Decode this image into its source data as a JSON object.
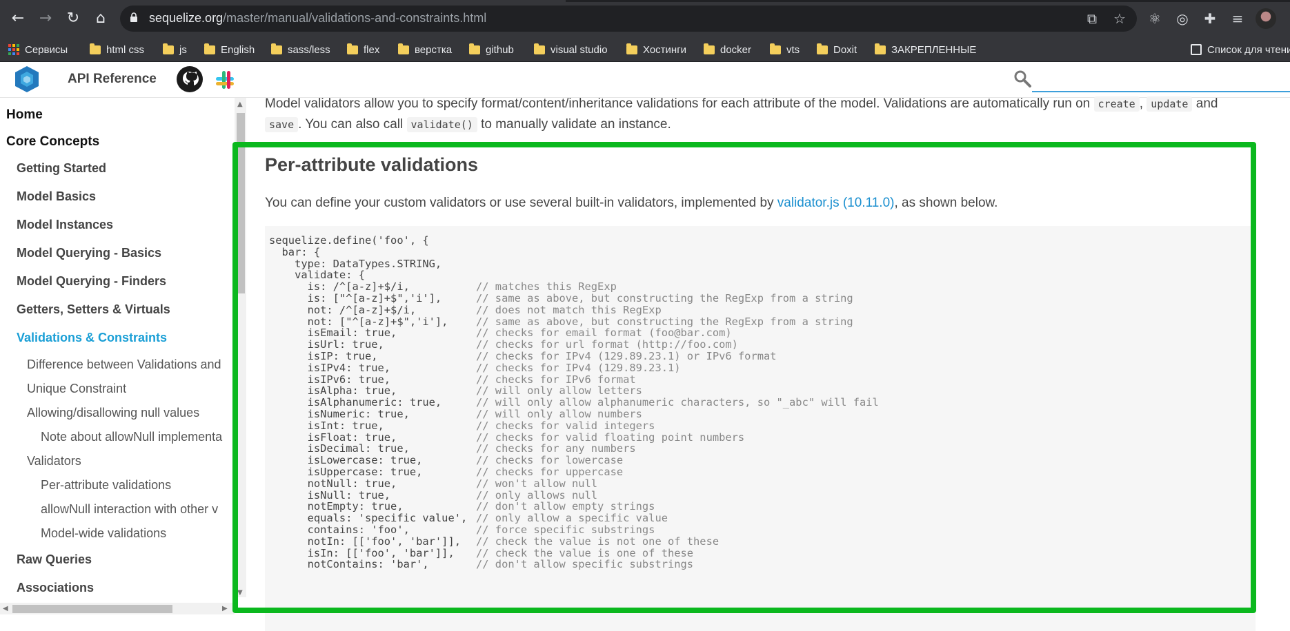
{
  "browser": {
    "url_host": "sequelize.org",
    "url_path": "/master/manual/validations-and-constraints.html"
  },
  "bookmarks": {
    "apps_label": "Сервисы",
    "items": [
      "html css",
      "js",
      "English",
      "sass/less",
      "flex",
      "верстка",
      "github",
      "visual studio",
      "Хостинги",
      "docker",
      "vts",
      "Doxit",
      "ЗАКРЕПЛЕННЫЕ"
    ],
    "reading_list": "Список для чтени"
  },
  "header": {
    "title": "API Reference",
    "search_value": ""
  },
  "sidebar": {
    "home": "Home",
    "core": "Core Concepts",
    "items": [
      "Getting Started",
      "Model Basics",
      "Model Instances",
      "Model Querying - Basics",
      "Model Querying - Finders",
      "Getters, Setters & Virtuals",
      "Validations & Constraints"
    ],
    "sub": [
      "Difference between Validations and",
      "Unique Constraint",
      "Allowing/disallowing null values",
      "Note about allowNull implementa",
      "Validators",
      "Per-attribute validations",
      "allowNull interaction with other v",
      "Model-wide validations"
    ],
    "after": [
      "Raw Queries",
      "Associations"
    ]
  },
  "content": {
    "intro_1": "Model validators allow you to specify format/content/inheritance validations for each attribute of the model. Validations are automatically run on ",
    "code_create": "create",
    "sep1": ", ",
    "code_update": "update",
    "and": " and",
    "code_save": "save",
    "intro_2": ". You can also call ",
    "code_validate": "validate()",
    "intro_3": " to manually validate an instance.",
    "heading": "Per-attribute validations",
    "para_1": "You can define your custom validators or use several built-in validators, implemented by ",
    "para_link": "validator.js (10.11.0)",
    "para_2": ", as shown below.",
    "code_lines": [
      {
        "code": "sequelize.define('foo', {",
        "comment": ""
      },
      {
        "code": "  bar: {",
        "comment": ""
      },
      {
        "code": "    type: DataTypes.STRING,",
        "comment": ""
      },
      {
        "code": "    validate: {",
        "comment": ""
      },
      {
        "code": "      is: /^[a-z]+$/i,",
        "comment": "// matches this RegExp"
      },
      {
        "code": "      is: [\"^[a-z]+$\",'i'],",
        "comment": "// same as above, but constructing the RegExp from a string"
      },
      {
        "code": "      not: /^[a-z]+$/i,",
        "comment": "// does not match this RegExp"
      },
      {
        "code": "      not: [\"^[a-z]+$\",'i'],",
        "comment": "// same as above, but constructing the RegExp from a string"
      },
      {
        "code": "      isEmail: true,",
        "comment": "// checks for email format (foo@bar.com)"
      },
      {
        "code": "      isUrl: true,",
        "comment": "// checks for url format (http://foo.com)"
      },
      {
        "code": "      isIP: true,",
        "comment": "// checks for IPv4 (129.89.23.1) or IPv6 format"
      },
      {
        "code": "      isIPv4: true,",
        "comment": "// checks for IPv4 (129.89.23.1)"
      },
      {
        "code": "      isIPv6: true,",
        "comment": "// checks for IPv6 format"
      },
      {
        "code": "      isAlpha: true,",
        "comment": "// will only allow letters"
      },
      {
        "code": "      isAlphanumeric: true,",
        "comment": "// will only allow alphanumeric characters, so \"_abc\" will fail"
      },
      {
        "code": "      isNumeric: true,",
        "comment": "// will only allow numbers"
      },
      {
        "code": "      isInt: true,",
        "comment": "// checks for valid integers"
      },
      {
        "code": "      isFloat: true,",
        "comment": "// checks for valid floating point numbers"
      },
      {
        "code": "      isDecimal: true,",
        "comment": "// checks for any numbers"
      },
      {
        "code": "      isLowercase: true,",
        "comment": "// checks for lowercase"
      },
      {
        "code": "      isUppercase: true,",
        "comment": "// checks for uppercase"
      },
      {
        "code": "      notNull: true,",
        "comment": "// won't allow null"
      },
      {
        "code": "      isNull: true,",
        "comment": "// only allows null"
      },
      {
        "code": "      notEmpty: true,",
        "comment": "// don't allow empty strings"
      },
      {
        "code": "      equals: 'specific value',",
        "comment": "// only allow a specific value"
      },
      {
        "code": "      contains: 'foo',",
        "comment": "// force specific substrings"
      },
      {
        "code": "      notIn: [['foo', 'bar']],",
        "comment": "// check the value is not one of these"
      },
      {
        "code": "      isIn: [['foo', 'bar']],",
        "comment": "// check the value is one of these"
      },
      {
        "code": "      notContains: 'bar',",
        "comment": "// don't allow specific substrings"
      }
    ]
  },
  "colors": {
    "highlight": "#0bb81e",
    "link": "#1a8fcf",
    "active_nav": "#1a9fd6"
  }
}
